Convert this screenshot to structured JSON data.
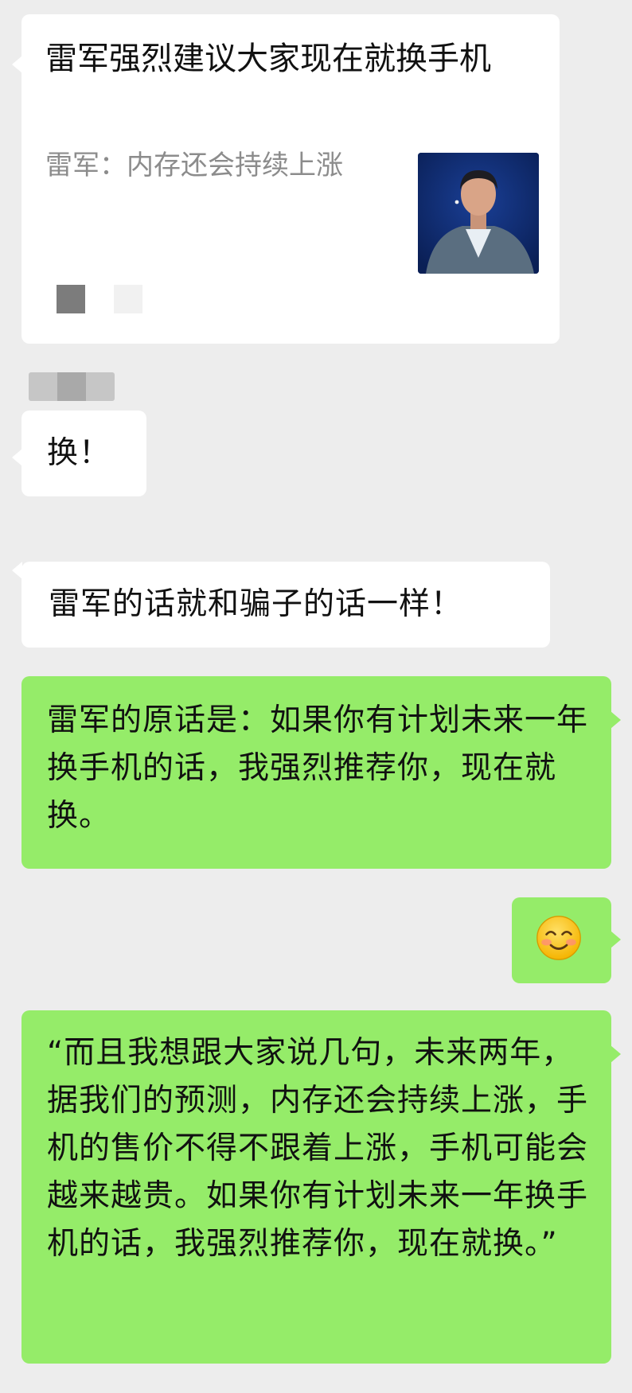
{
  "conversation": {
    "messages": [
      {
        "type": "link_card",
        "direction": "incoming",
        "title": "雷军强烈建议大家现在就换手机",
        "description": "雷军：内存还会持续上涨"
      },
      {
        "type": "text",
        "direction": "incoming",
        "text": "换！"
      },
      {
        "type": "text",
        "direction": "incoming",
        "text": "雷军的话就和骗子的话一样！"
      },
      {
        "type": "text",
        "direction": "outgoing",
        "text": "雷军的原话是：如果你有计划未来一年换手机的话，我强烈推荐你，现在就换。"
      },
      {
        "type": "emoji",
        "direction": "outgoing",
        "icon": "smiling-face-icon"
      },
      {
        "type": "text",
        "direction": "outgoing",
        "text": "“而且我想跟大家说几句，未来两年，据我们的预测，内存还会持续上涨，手机的售价不得不跟着上涨，手机可能会越来越贵。如果你有计划未来一年换手机的话，我强烈推荐你，现在就换。”"
      }
    ]
  },
  "colors": {
    "background": "#ededed",
    "incoming_bubble": "#ffffff",
    "outgoing_bubble": "#95ec69"
  }
}
